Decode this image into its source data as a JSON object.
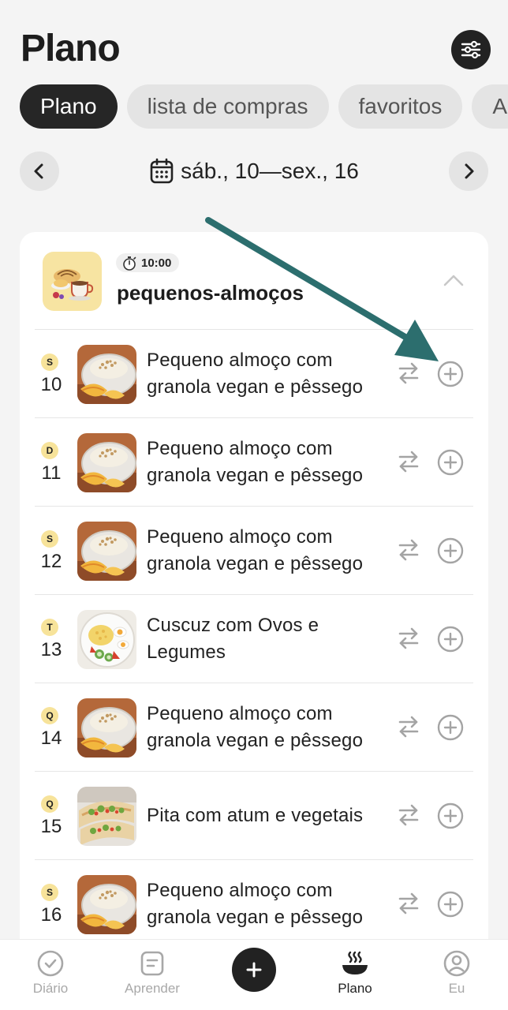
{
  "header": {
    "title": "Plano"
  },
  "tabs": [
    {
      "label": "Plano",
      "active": true
    },
    {
      "label": "lista de compras",
      "active": false
    },
    {
      "label": "favoritos",
      "active": false
    },
    {
      "label": "A",
      "active": false
    }
  ],
  "week": {
    "label": "sáb., 10—sex., 16"
  },
  "meal": {
    "time": "10:00",
    "name": "pequenos-almoços",
    "rows": [
      {
        "day_letter": "S",
        "day_num": "10",
        "recipe": "Pequeno almoço com granola vegan e pêssego",
        "thumb": "granola"
      },
      {
        "day_letter": "D",
        "day_num": "11",
        "recipe": "Pequeno almoço com granola vegan e pêssego",
        "thumb": "granola"
      },
      {
        "day_letter": "S",
        "day_num": "12",
        "recipe": "Pequeno almoço com granola vegan e pêssego",
        "thumb": "granola"
      },
      {
        "day_letter": "T",
        "day_num": "13",
        "recipe": "Cuscuz com Ovos e Legumes",
        "thumb": "cuscuz"
      },
      {
        "day_letter": "Q",
        "day_num": "14",
        "recipe": "Pequeno almoço com granola vegan e pêssego",
        "thumb": "granola"
      },
      {
        "day_letter": "Q",
        "day_num": "15",
        "recipe": "Pita com atum e vegetais",
        "thumb": "pita"
      },
      {
        "day_letter": "S",
        "day_num": "16",
        "recipe": "Pequeno almoço com granola vegan e pêssego",
        "thumb": "granola"
      }
    ]
  },
  "bottom_nav": [
    {
      "label": "Diário",
      "icon": "check-circle-icon",
      "active": false
    },
    {
      "label": "Aprender",
      "icon": "notes-icon",
      "active": false
    },
    {
      "label": "",
      "icon": "plus-icon",
      "active": false
    },
    {
      "label": "Plano",
      "icon": "food-bowl-icon",
      "active": true
    },
    {
      "label": "Eu",
      "icon": "profile-icon",
      "active": false
    }
  ],
  "colors": {
    "accent_dark": "#222222",
    "day_badge": "#f7e39a",
    "annotation_arrow": "#2c6e6e"
  }
}
